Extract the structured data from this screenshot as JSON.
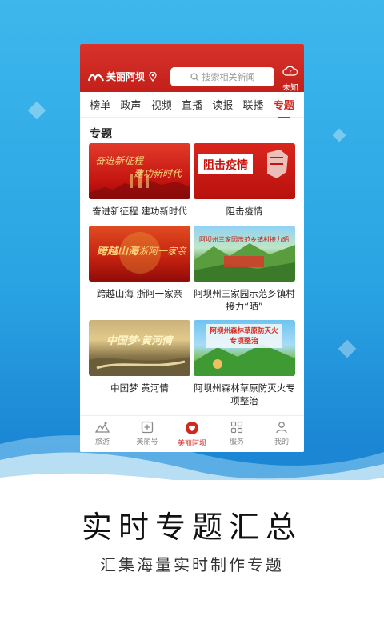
{
  "header": {
    "logo_text": "美丽阿坝",
    "search_placeholder": "搜索相关新闻",
    "weather_text": "未知",
    "weather_icon": "cloud-question-icon",
    "brand_color": "#c8241d"
  },
  "tabs": [
    {
      "label": "榜单",
      "active": false
    },
    {
      "label": "政声",
      "active": false
    },
    {
      "label": "视频",
      "active": false
    },
    {
      "label": "直播",
      "active": false
    },
    {
      "label": "读报",
      "active": false
    },
    {
      "label": "联播",
      "active": false
    },
    {
      "label": "专题",
      "active": true
    }
  ],
  "section_title": "专题",
  "cards": [
    {
      "caption": "奋进新征程 建功新时代",
      "thumb_text": [
        "奋进新征程",
        "建功新时代"
      ]
    },
    {
      "caption": "阻击疫情",
      "thumb_text": [
        "阻击疫情"
      ]
    },
    {
      "caption": "跨越山海 浙阿一家亲",
      "thumb_text": [
        "跨越山海",
        "浙阿一家亲"
      ]
    },
    {
      "caption": "阿坝州三家园示范乡镇村接力“晒”",
      "thumb_text": [
        "阿坝州三家园示范乡镇村接力晒"
      ]
    },
    {
      "caption": "中国梦 黄河情",
      "thumb_text": [
        "中国梦·黄河情"
      ]
    },
    {
      "caption": "阿坝州森林草原防灭火专项整治",
      "thumb_text": [
        "阿坝州森林草原防灭火",
        "专项整治"
      ]
    }
  ],
  "bottom_nav": [
    {
      "label": "旅游",
      "icon": "mountain-icon",
      "active": false
    },
    {
      "label": "美丽号",
      "icon": "plus-square-icon",
      "active": false
    },
    {
      "label": "美丽阿坝",
      "icon": "heart-circle-icon",
      "active": true
    },
    {
      "label": "服务",
      "icon": "grid-icon",
      "active": false
    },
    {
      "label": "我的",
      "icon": "user-icon",
      "active": false
    }
  ],
  "promo": {
    "title": "实时专题汇总",
    "subtitle": "汇集海量实时制作专题"
  }
}
